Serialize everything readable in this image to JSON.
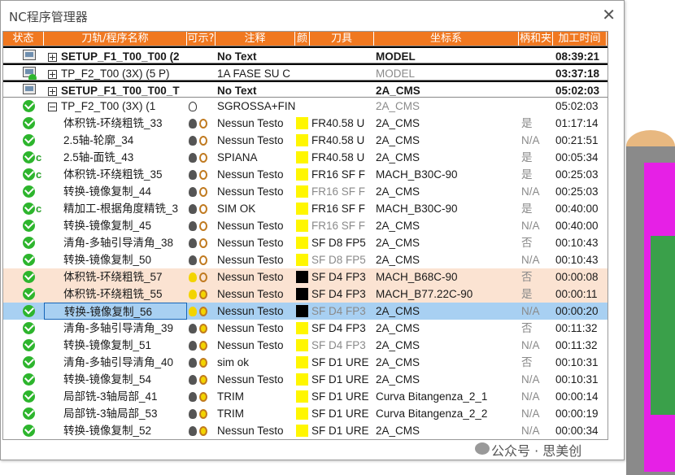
{
  "window": {
    "title": "NC程序管理器",
    "close": "✕"
  },
  "headers": [
    "状态",
    "刀轨/程序名称",
    "可示?",
    "注释",
    "颜",
    "刀具",
    "坐标系",
    "柄和夹",
    "加工时间"
  ],
  "rows": [
    {
      "type": "setup",
      "status": "setup",
      "expand": "plus",
      "name": "SETUP_F1_T00_T00 (2",
      "comment": "No Text",
      "cs": "MODEL",
      "time": "08:39:21",
      "bold": true
    },
    {
      "type": "setup",
      "status": "setup-check",
      "expand": "plus",
      "name": "TP_F2_T00 (3X) (5 P)",
      "comment": "1A FASE SU C",
      "cs": "MODEL",
      "time": "03:37:18",
      "bold": false,
      "gray_cs": true
    },
    {
      "type": "setup",
      "status": "setup",
      "expand": "plus",
      "name": "SETUP_F1_T00_T00_T",
      "comment": "No Text",
      "cs": "2A_CMS",
      "time": "05:02:03",
      "bold": true
    },
    {
      "type": "group",
      "status": "check",
      "expand": "minus",
      "name": "TP_F2_T00 (3X) (1",
      "comment": "SGROSSA+FIN",
      "cs": "2A_CMS",
      "time": "05:02:03",
      "gray_cs": true,
      "bulb": "o"
    },
    {
      "name": "体积铣-环绕粗铣_33",
      "comment": "Nessun Testo",
      "color": "y",
      "tool": "FR40.58 U",
      "cs": "2A_CMS",
      "holder": "是",
      "time": "01:17:14",
      "status": "check"
    },
    {
      "name": "2.5轴-轮廓_34",
      "comment": "Nessun Testo",
      "color": "y",
      "tool": "FR40.58 U",
      "cs": "2A_CMS",
      "holder": "N/A",
      "time": "00:21:51",
      "status": "check"
    },
    {
      "name": "2.5轴-面铣_43",
      "comment": "SPIANA",
      "color": "y",
      "tool": "FR40.58 U",
      "cs": "2A_CMS",
      "holder": "是",
      "time": "00:05:34",
      "status": "check",
      "c": true
    },
    {
      "name": "体积铣-环绕粗铣_35",
      "comment": "Nessun Testo",
      "color": "y",
      "tool": "FR16 SF F",
      "cs": "MACH_B30C-90",
      "holder": "是",
      "time": "00:25:03",
      "status": "check",
      "c": true
    },
    {
      "name": "转换-镜像复制_44",
      "comment": "Nessun Testo",
      "color": "y",
      "tool": "FR16 SF F",
      "gray_tool": true,
      "cs": "2A_CMS",
      "holder": "N/A",
      "time": "00:25:03",
      "status": "check"
    },
    {
      "name": "精加工-根据角度精铣_3",
      "comment": "SIM OK",
      "color": "y",
      "tool": "FR16 SF F",
      "cs": "MACH_B30C-90",
      "holder": "是",
      "time": "00:40:00",
      "status": "check",
      "c": true
    },
    {
      "name": "转换-镜像复制_45",
      "comment": "Nessun Testo",
      "color": "y",
      "tool": "FR16 SF F",
      "gray_tool": true,
      "cs": "2A_CMS",
      "holder": "N/A",
      "time": "00:40:00",
      "status": "check"
    },
    {
      "name": "清角-多轴引导清角_38",
      "comment": "Nessun Testo",
      "color": "y",
      "tool": "SF D8 FP5",
      "cs": "2A_CMS",
      "holder": "否",
      "time": "00:10:43",
      "status": "check"
    },
    {
      "name": "转换-镜像复制_50",
      "comment": "Nessun Testo",
      "color": "y",
      "tool": "SF D8 FP5",
      "gray_tool": true,
      "cs": "2A_CMS",
      "holder": "N/A",
      "time": "00:10:43",
      "status": "check"
    },
    {
      "name": "体积铣-环绕粗铣_57",
      "comment": "Nessun Testo",
      "color": "k",
      "tool": "SF D4 FP3",
      "cs": "MACH_B68C-90",
      "holder": "否",
      "time": "00:00:08",
      "status": "check",
      "hl": "orange",
      "ybulb": true
    },
    {
      "name": "体积铣-环绕粗铣_55",
      "comment": "Nessun Testo",
      "color": "k",
      "tool": "SF D4 FP3",
      "cs": "MACH_B77.22C-90",
      "holder": "是",
      "time": "00:00:11",
      "status": "check",
      "hl": "orange",
      "ybulb": true,
      "mtool": true
    },
    {
      "name": "转换-镜像复制_56",
      "comment": "Nessun Testo",
      "color": "k",
      "tool": "SF D4 FP3",
      "gray_tool": true,
      "cs": "2A_CMS",
      "holder": "N/A",
      "time": "00:00:20",
      "status": "check",
      "hl": "blue",
      "ybulb": true,
      "mtool": true
    },
    {
      "name": "清角-多轴引导清角_39",
      "comment": "Nessun Testo",
      "color": "y",
      "tool": "SF D4 FP3",
      "cs": "2A_CMS",
      "holder": "否",
      "time": "00:11:32",
      "status": "check",
      "mtool": true
    },
    {
      "name": "转换-镜像复制_51",
      "comment": "Nessun Testo",
      "color": "y",
      "tool": "SF D4 FP3",
      "gray_tool": true,
      "cs": "2A_CMS",
      "holder": "N/A",
      "time": "00:11:32",
      "status": "check",
      "mtool": true
    },
    {
      "name": "清角-多轴引导清角_40",
      "comment": "sim ok",
      "color": "y",
      "tool": "SF D1 URE",
      "cs": "2A_CMS",
      "holder": "否",
      "time": "00:10:31",
      "status": "check",
      "mtool": true
    },
    {
      "name": "转换-镜像复制_54",
      "comment": "Nessun Testo",
      "color": "y",
      "tool": "SF D1 URE",
      "cs": "2A_CMS",
      "holder": "N/A",
      "time": "00:10:31",
      "status": "check",
      "mtool": true
    },
    {
      "name": "局部铣-3轴局部_41",
      "comment": "TRIM",
      "color": "y",
      "tool": "SF D1 URE",
      "cs": "Curva Bitangenza_2_1",
      "holder": "N/A",
      "time": "00:00:14",
      "status": "check",
      "mtool": true
    },
    {
      "name": "局部铣-3轴局部_53",
      "comment": "TRIM",
      "color": "y",
      "tool": "SF D1 URE",
      "cs": "Curva Bitangenza_2_2",
      "holder": "N/A",
      "time": "00:00:19",
      "status": "check",
      "mtool": true
    },
    {
      "name": "转换-镜像复制_52",
      "comment": "Nessun Testo",
      "color": "y",
      "tool": "SF D1 URE",
      "cs": "2A_CMS",
      "holder": "N/A",
      "time": "00:00:34",
      "status": "check",
      "mtool": true
    }
  ],
  "watermark": "公众号 · 思美创",
  "colors": {
    "header": "#f07820",
    "check": "#2db52d",
    "yellow": "#fff600",
    "highlight_orange": "#fbe3d2",
    "highlight_blue": "#a8d0f2"
  }
}
